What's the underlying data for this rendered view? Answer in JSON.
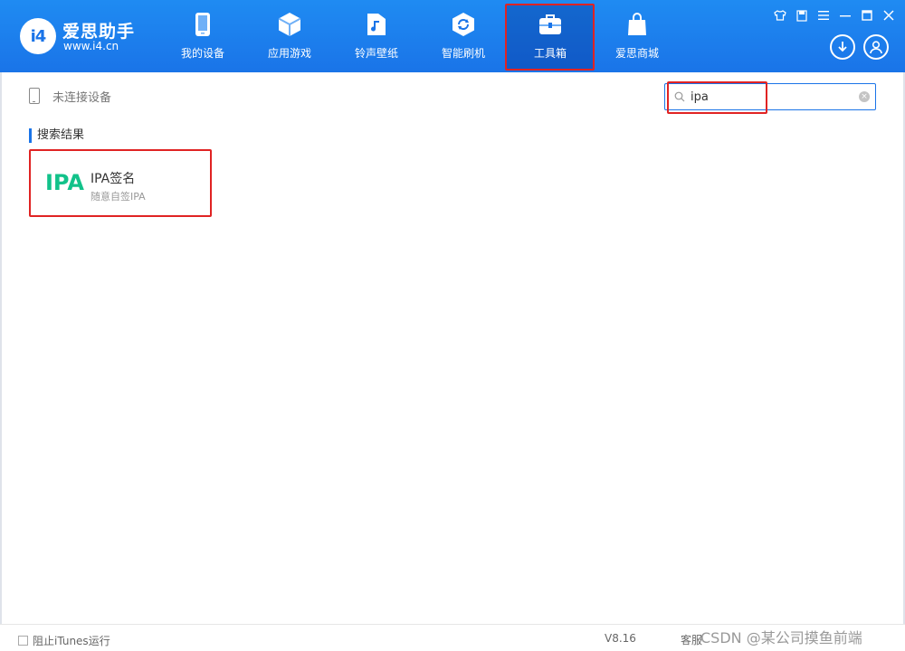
{
  "app": {
    "logo_badge": "i4",
    "name": "爱思助手",
    "url": "www.i4.cn"
  },
  "nav": {
    "items": [
      {
        "label": "我的设备",
        "icon": "phone-icon"
      },
      {
        "label": "应用游戏",
        "icon": "cube-icon"
      },
      {
        "label": "铃声壁纸",
        "icon": "music-folder-icon"
      },
      {
        "label": "智能刷机",
        "icon": "refresh-shield-icon"
      },
      {
        "label": "工具箱",
        "icon": "toolbox-icon"
      },
      {
        "label": "爱思商城",
        "icon": "shopping-bag-icon"
      }
    ],
    "active_index": 4
  },
  "window_controls": {
    "icons": [
      "shirt-icon",
      "notes-icon",
      "menu-icon",
      "minimize-icon",
      "maximize-icon",
      "close-icon"
    ]
  },
  "toolbar": {
    "download_icon": "download-icon",
    "user_icon": "user-icon"
  },
  "device": {
    "status": "未连接设备"
  },
  "search": {
    "value": "ipa",
    "placeholder": ""
  },
  "results": {
    "title": "搜索结果",
    "items": [
      {
        "logo_text": "IPA",
        "name": "IPA签名",
        "desc": "随意自签IPA"
      }
    ]
  },
  "footer": {
    "itunes_label": "阻止iTunes运行",
    "itunes_checked": false,
    "version": "V8.16",
    "service": "客服"
  },
  "watermark": "CSDN @某公司摸鱼前端",
  "colors": {
    "header_blue": "#1a74e8",
    "accent_green": "#12c28a",
    "highlight_red": "#e02323"
  }
}
